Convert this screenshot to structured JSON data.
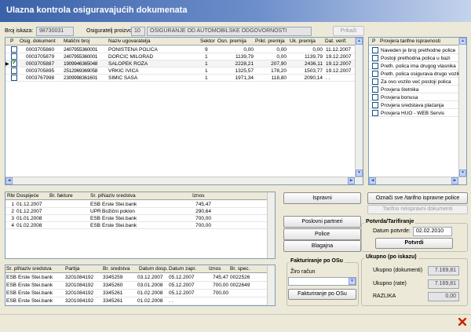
{
  "window": {
    "title": "Ulazna kontrola osiguravajućih dokumenata"
  },
  "header": {
    "broj_label": "Broj iskaza:",
    "broj_value": "98730031",
    "osig_label": "Osiguratelj proizvod:",
    "osig_code": "10",
    "osig_name": "OSIGURANJE OD AUTOMOBILSKE ODGOVORNOSTI",
    "prikazi_label": "Prikaži"
  },
  "main_grid": {
    "columns": [
      "P",
      "Osig. dokument",
      "Matični broj",
      "Naziv ugovaratelja",
      "Sektor",
      "Osn. premija",
      "Prikl. premija",
      "Uk. premija",
      "Dat. verif."
    ],
    "rows": [
      {
        "checked": false,
        "current": false,
        "doc": "0003705860",
        "mb": "2407955360001",
        "naziv": "PONIŠTENA POLICA",
        "sektor": "9",
        "osn": "0,00",
        "prikl": "0,00",
        "uk": "0,00",
        "dat": "11.12.2007"
      },
      {
        "checked": false,
        "current": false,
        "doc": "0003705879",
        "mb": "2407955360001",
        "naziv": "DORČIĆ MILORAD",
        "sektor": "1",
        "osn": "1139,79",
        "prikl": "0,00",
        "uk": "1139,79",
        "dat": "19.12.2007"
      },
      {
        "checked": true,
        "current": true,
        "doc": "0003705887",
        "mb": "1909946365048",
        "naziv": "ŠALOPEK ROŽA",
        "sektor": "1",
        "osn": "2228,21",
        "prikl": "207,90",
        "uk": "2436,11",
        "dat": "19.12.2007"
      },
      {
        "checked": false,
        "current": false,
        "doc": "0003705895",
        "mb": "2512969369058",
        "naziv": "VRKIĆ IVICA",
        "sektor": "1",
        "osn": "1325,57",
        "prikl": "178,20",
        "uk": "1503,77",
        "dat": "19.12.2007"
      },
      {
        "checked": false,
        "current": false,
        "doc": "0003767998",
        "mb": "2309998361601",
        "naziv": "ŠIMIĆ SAŠA",
        "sektor": "1",
        "osn": "1971,34",
        "prikl": "118,80",
        "uk": "2090,14",
        "dat": ". ."
      }
    ]
  },
  "rules_grid": {
    "columns": [
      "P",
      "Provjera tarifne ispravnosti"
    ],
    "rows": [
      {
        "checked": false,
        "label": "Naveden je broj prethodne police"
      },
      {
        "checked": false,
        "label": "Postoji prethodna polica u bazi"
      },
      {
        "checked": false,
        "label": "Preth. polica ima drugog vlasnika"
      },
      {
        "checked": false,
        "label": "Preth. polica osigurava drugo vozilo"
      },
      {
        "checked": false,
        "label": "Za ovo vozilo već postoji polica"
      },
      {
        "checked": false,
        "label": "Provjera štetnika"
      },
      {
        "checked": false,
        "label": "Provjera bonusa"
      },
      {
        "checked": false,
        "label": "Provjera sredstava plaćanja"
      },
      {
        "checked": false,
        "label": "Provjera HUO - WEB Servis"
      }
    ]
  },
  "payments_grid": {
    "columns": [
      "Rbr",
      "Dospijeće",
      "Br. fakture",
      "Sr. pl.",
      "Naziv sredstva",
      "Iznos"
    ],
    "rows": [
      {
        "rbr": "1",
        "dosp": "01.12.2007",
        "fakt": "",
        "srpl": "ESB",
        "naziv": "Erste Stei.bank",
        "iznos": "745,47"
      },
      {
        "rbr": "2",
        "dosp": "01.12.2007",
        "fakt": "",
        "srpl": "UPR",
        "naziv": "Božični poklon",
        "iznos": "290,64"
      },
      {
        "rbr": "3",
        "dosp": "01.01.2008",
        "fakt": "",
        "srpl": "ESB",
        "naziv": "Erste Stei.bank",
        "iznos": "700,00"
      },
      {
        "rbr": "4",
        "dosp": "01.02.2008",
        "fakt": "",
        "srpl": "ESB",
        "naziv": "Erste Stei.bank",
        "iznos": "700,00"
      }
    ]
  },
  "means_grid": {
    "columns": [
      "Sr. pl.",
      "Naziv sredstva",
      "Partija",
      "Br. sredstva",
      "Datum dosp.",
      "Datum zapr.",
      "Iznos",
      "Br. spec."
    ],
    "rows": [
      {
        "srpl": "ESB",
        "naziv": "Erste Stei.bank",
        "partija": "3201084192",
        "brsr": "3345259",
        "dosp": "03.12.2007",
        "zapr": "05.12.2007",
        "iznos": "745,47",
        "spec": "0022526"
      },
      {
        "srpl": "ESB",
        "naziv": "Erste Stei.bank",
        "partija": "3201084192",
        "brsr": "3345260",
        "dosp": "03.01.2008",
        "zapr": "05.12.2007",
        "iznos": "700,00",
        "spec": "0022649"
      },
      {
        "srpl": "ESB",
        "naziv": "Erste Stei.bank",
        "partija": "3201084192",
        "brsr": "3345261",
        "dosp": "01.02.2008",
        "zapr": "05.12.2007",
        "iznos": "700,00",
        "spec": ""
      },
      {
        "srpl": "ESB",
        "naziv": "Erste Stei.bank",
        "partija": "3201084192",
        "brsr": "3345261",
        "dosp": "01.02.2008",
        "zapr": ". .",
        "iznos": "",
        "spec": ""
      }
    ]
  },
  "buttons": {
    "ispravni": "Ispravni",
    "oznaci_sve": "Označi sve /tarifno ispravne police",
    "tarifno_neispravni": "Tarifno neispravni dokumenti",
    "poslovni_partneri": "Poslovni partneri",
    "police": "Police",
    "blagajna": "Blagajna",
    "fakturiranje_po_osu": "Fakturiranje po OSu",
    "potvrdi": "Potvrdi"
  },
  "potvrda": {
    "title": "Potvrda/Tarifiranje",
    "datum_label": "Datum potvrde:",
    "datum_value": "02.02.2010"
  },
  "fakturiranje": {
    "title": "Fakturiranje po OSu",
    "ziro_label": "Žiro račun",
    "ziro_value": ""
  },
  "ukupno": {
    "title": "Ukupno (po iskazu)",
    "dok_label": "Ukupno (dokumenti)",
    "dok_value": "7.169,81",
    "rate_label": "Ukupno (rate)",
    "rate_value": "7.169,81",
    "razlika_label": "RAZLIKA",
    "razlika_value": "0,00"
  },
  "colors": {
    "title_start": "#3a61a8",
    "close_icon": "#cc2200"
  }
}
